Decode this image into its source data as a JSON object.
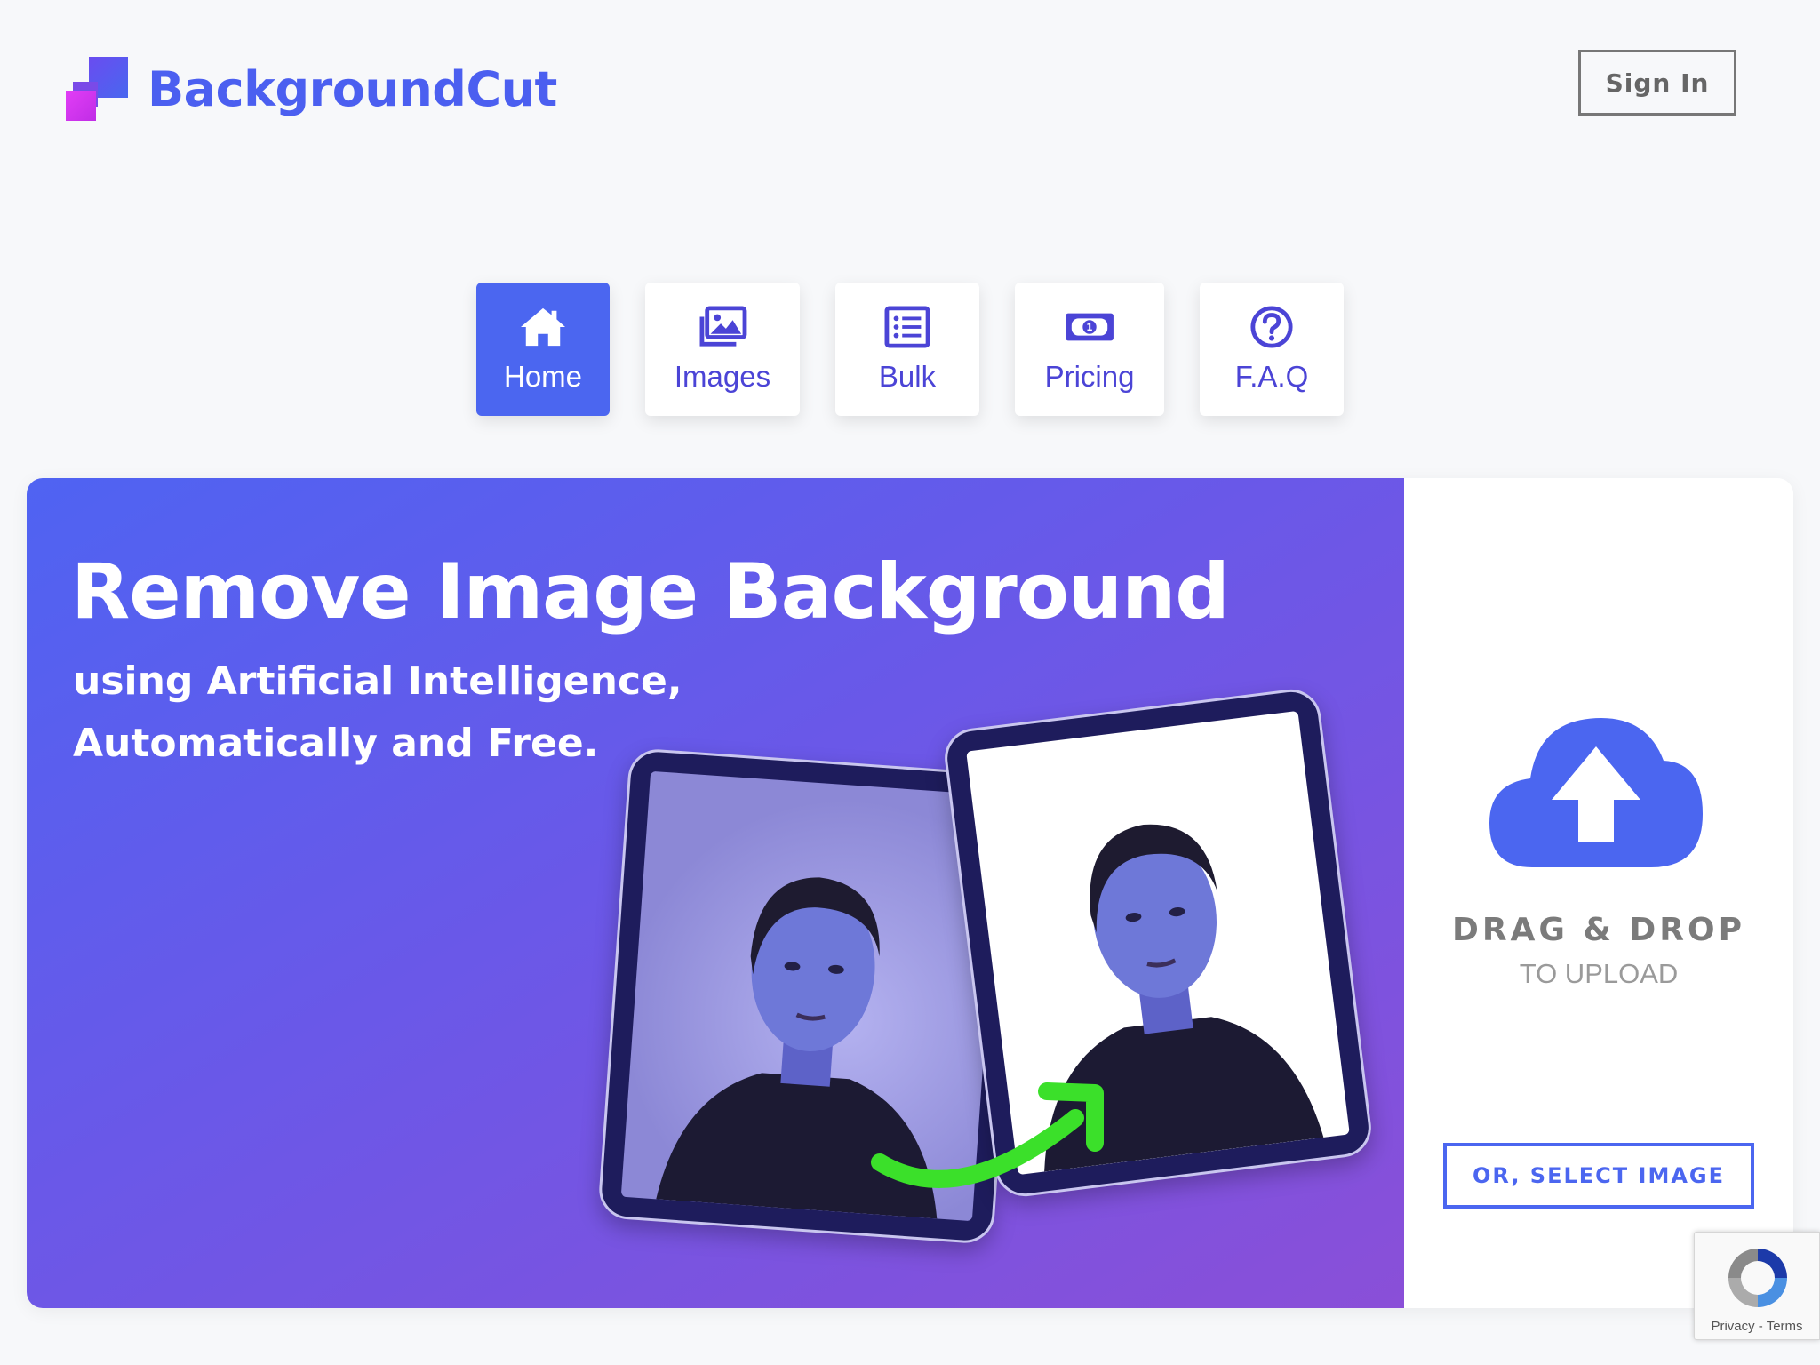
{
  "header": {
    "brand": "BackgroundCut",
    "signin_label": "Sign In"
  },
  "nav": {
    "items": [
      {
        "label": "Home",
        "icon": "home-icon",
        "active": true
      },
      {
        "label": "Images",
        "icon": "images-icon",
        "active": false
      },
      {
        "label": "Bulk",
        "icon": "list-icon",
        "active": false
      },
      {
        "label": "Pricing",
        "icon": "money-bill-icon",
        "active": false
      },
      {
        "label": "F.A.Q",
        "icon": "question-circle-icon",
        "active": false
      }
    ]
  },
  "hero": {
    "title": "Remove Image Background",
    "subtitle_line1": "using Artificial Intelligence,",
    "subtitle_line2": "Automatically and Free."
  },
  "upload": {
    "drag_title": "DRAG & DROP",
    "drag_sub": "TO UPLOAD",
    "select_label": "OR, SELECT IMAGE",
    "icon": "cloud-upload-icon"
  },
  "recaptcha": {
    "privacy": "Privacy",
    "separator": " - ",
    "terms": "Terms"
  },
  "colors": {
    "brand": "#4b5ff0",
    "accent": "#4b66f0",
    "arrow_green": "#3be02a",
    "page_bg": "#f7f8fa"
  }
}
